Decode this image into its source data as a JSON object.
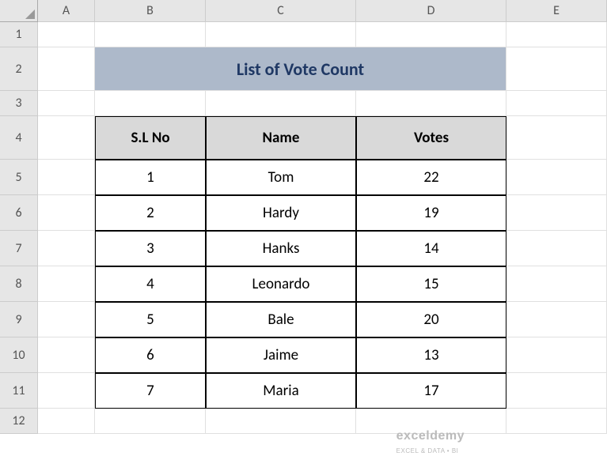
{
  "columns": [
    "A",
    "B",
    "C",
    "D",
    "E"
  ],
  "row_numbers": [
    "1",
    "2",
    "3",
    "4",
    "5",
    "6",
    "7",
    "8",
    "9",
    "10",
    "11",
    "12"
  ],
  "title": "List of Vote Count",
  "table": {
    "headers": [
      "S.L No",
      "Name",
      "Votes"
    ],
    "rows": [
      {
        "sl": "1",
        "name": "Tom",
        "votes": "22"
      },
      {
        "sl": "2",
        "name": "Hardy",
        "votes": "19"
      },
      {
        "sl": "3",
        "name": "Hanks",
        "votes": "14"
      },
      {
        "sl": "4",
        "name": "Leonardo",
        "votes": "15"
      },
      {
        "sl": "5",
        "name": "Bale",
        "votes": "20"
      },
      {
        "sl": "6",
        "name": "Jaime",
        "votes": "13"
      },
      {
        "sl": "7",
        "name": "Maria",
        "votes": "17"
      }
    ]
  },
  "watermark": {
    "main": "exceldemy",
    "sub": "EXCEL & DATA • BI"
  },
  "chart_data": {
    "type": "table",
    "title": "List of Vote Count",
    "columns": [
      "S.L No",
      "Name",
      "Votes"
    ],
    "data": [
      [
        1,
        "Tom",
        22
      ],
      [
        2,
        "Hardy",
        19
      ],
      [
        3,
        "Hanks",
        14
      ],
      [
        4,
        "Leonardo",
        15
      ],
      [
        5,
        "Bale",
        20
      ],
      [
        6,
        "Jaime",
        13
      ],
      [
        7,
        "Maria",
        17
      ]
    ]
  }
}
